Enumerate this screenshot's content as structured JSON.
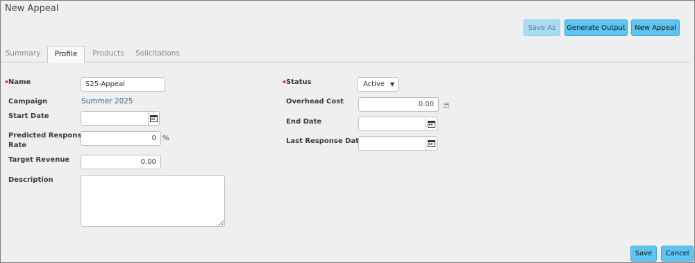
{
  "page": {
    "title": "New Appeal"
  },
  "toolbar": {
    "save_as": "Save As",
    "generate_output": "Generate Output",
    "new_appeal": "New Appeal"
  },
  "tabs": [
    {
      "label": "Summary",
      "active": false
    },
    {
      "label": "Profile",
      "active": true
    },
    {
      "label": "Products",
      "active": false
    },
    {
      "label": "Solicitations",
      "active": false
    }
  ],
  "form": {
    "name": {
      "label": "Name",
      "value": "S25-Appeal",
      "required": true
    },
    "campaign": {
      "label": "Campaign",
      "value": "Summer 2025"
    },
    "start_date": {
      "label": "Start Date",
      "value": ""
    },
    "predicted_response_rate": {
      "label_line1": "Predicted Response",
      "label_line2": "Rate",
      "value": "0",
      "unit": "%"
    },
    "target_revenue": {
      "label": "Target Revenue",
      "value": "0.00"
    },
    "description": {
      "label": "Description",
      "value": ""
    },
    "status": {
      "label": "Status",
      "value": "Active",
      "required": true
    },
    "overhead_cost": {
      "label": "Overhead Cost",
      "value": "0.00"
    },
    "end_date": {
      "label": "End Date",
      "value": ""
    },
    "last_response_date": {
      "label": "Last Response Date",
      "value": ""
    }
  },
  "footer": {
    "save": "Save",
    "cancel": "Cancel"
  },
  "colors": {
    "accent": "#5ec4f0",
    "required": "#d0311f",
    "link": "#2a6f9e"
  },
  "icons": {
    "date_picker": "calendar-icon",
    "expand": "plus-box-icon",
    "dropdown": "chevron-down-icon"
  }
}
